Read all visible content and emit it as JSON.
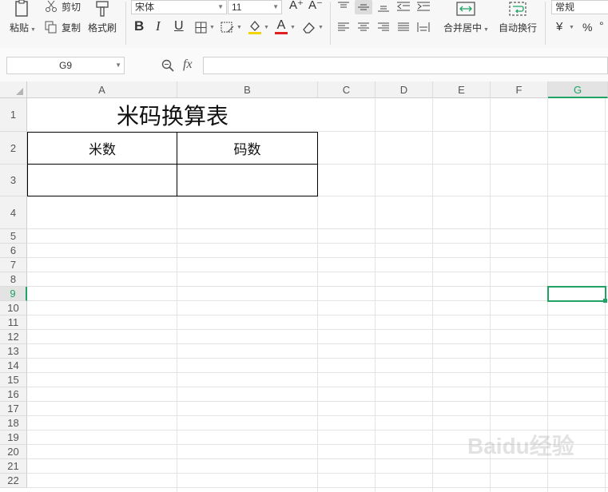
{
  "ribbon": {
    "paste_label": "粘贴",
    "cut_label": "剪切",
    "copy_label": "复制",
    "format_painter_label": "格式刷",
    "font_name": "宋体",
    "font_size": "11",
    "increase_font": "A⁺",
    "decrease_font": "A⁻",
    "bold": "B",
    "italic": "I",
    "underline": "U",
    "font_color_letter": "A",
    "merge_center_label": "合并居中",
    "wrap_text_label": "自动换行",
    "number_format": "常规",
    "currency_symbol": "¥",
    "percent_symbol": "%"
  },
  "formula_bar": {
    "name_box": "G9",
    "fx_label": "fx",
    "formula": ""
  },
  "columns": [
    "A",
    "B",
    "C",
    "D",
    "E",
    "F",
    "G"
  ],
  "rows": [
    "1",
    "2",
    "3",
    "4",
    "5",
    "6",
    "7",
    "8",
    "9",
    "10",
    "11",
    "12",
    "13",
    "14",
    "15",
    "16",
    "17",
    "18",
    "19",
    "20",
    "21",
    "22"
  ],
  "selection": {
    "column": "G",
    "row": "9",
    "cell": "G9"
  },
  "cells": {
    "title": "米码换算表",
    "a2": "米数",
    "b2": "码数",
    "a3": "",
    "b3": ""
  },
  "colors": {
    "selection": "#21a366",
    "font_color_bar": "#e02020",
    "fill_color_bar": "#f6d400"
  },
  "watermark": "Baidu经验"
}
